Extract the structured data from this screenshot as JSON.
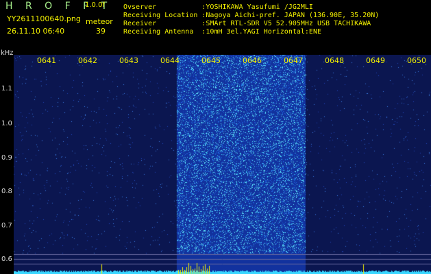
{
  "header": {
    "app_name": "H R O F F T",
    "version": "1.0.0f",
    "filename": "YY2611100640.png",
    "date_time": "26.11.10 06:40",
    "meteor_label": "meteor",
    "meteor_count": "39"
  },
  "info": [
    "Ovserver           :YOSHIKAWA Yasufumi /JG2MLI",
    "Receiving Location :Nagoya Aichi-pref. JAPAN (136.90E, 35.20N)",
    "Receiver           :SMArt RTL-SDR V5 52.905MHz USB TACHIKAWA",
    "Receiving Antenna  :10mH 3el.YAGI Horizontal:ENE"
  ],
  "colors": {
    "header_green": "#a8f08c",
    "tick_yellow": "#f2f000",
    "signal_cyan": "#39d6ff",
    "panel_blue": "#0a2a9c"
  },
  "plot": {
    "unit_label": "kHz",
    "y_ticks": [
      {
        "label": "1.1",
        "value": 1.1
      },
      {
        "label": "1.0",
        "value": 1.0
      },
      {
        "label": "0.9",
        "value": 0.9
      },
      {
        "label": "0.8",
        "value": 0.8
      },
      {
        "label": "0.7",
        "value": 0.7
      },
      {
        "label": "0.6",
        "value": 0.6
      }
    ],
    "time_ticks": [
      "0641",
      "0642",
      "0643",
      "0644",
      "0645",
      "0646",
      "0647",
      "0648",
      "0649",
      "0650"
    ],
    "highlight_minutes": [
      "0645",
      "0646",
      "0647"
    ]
  }
}
